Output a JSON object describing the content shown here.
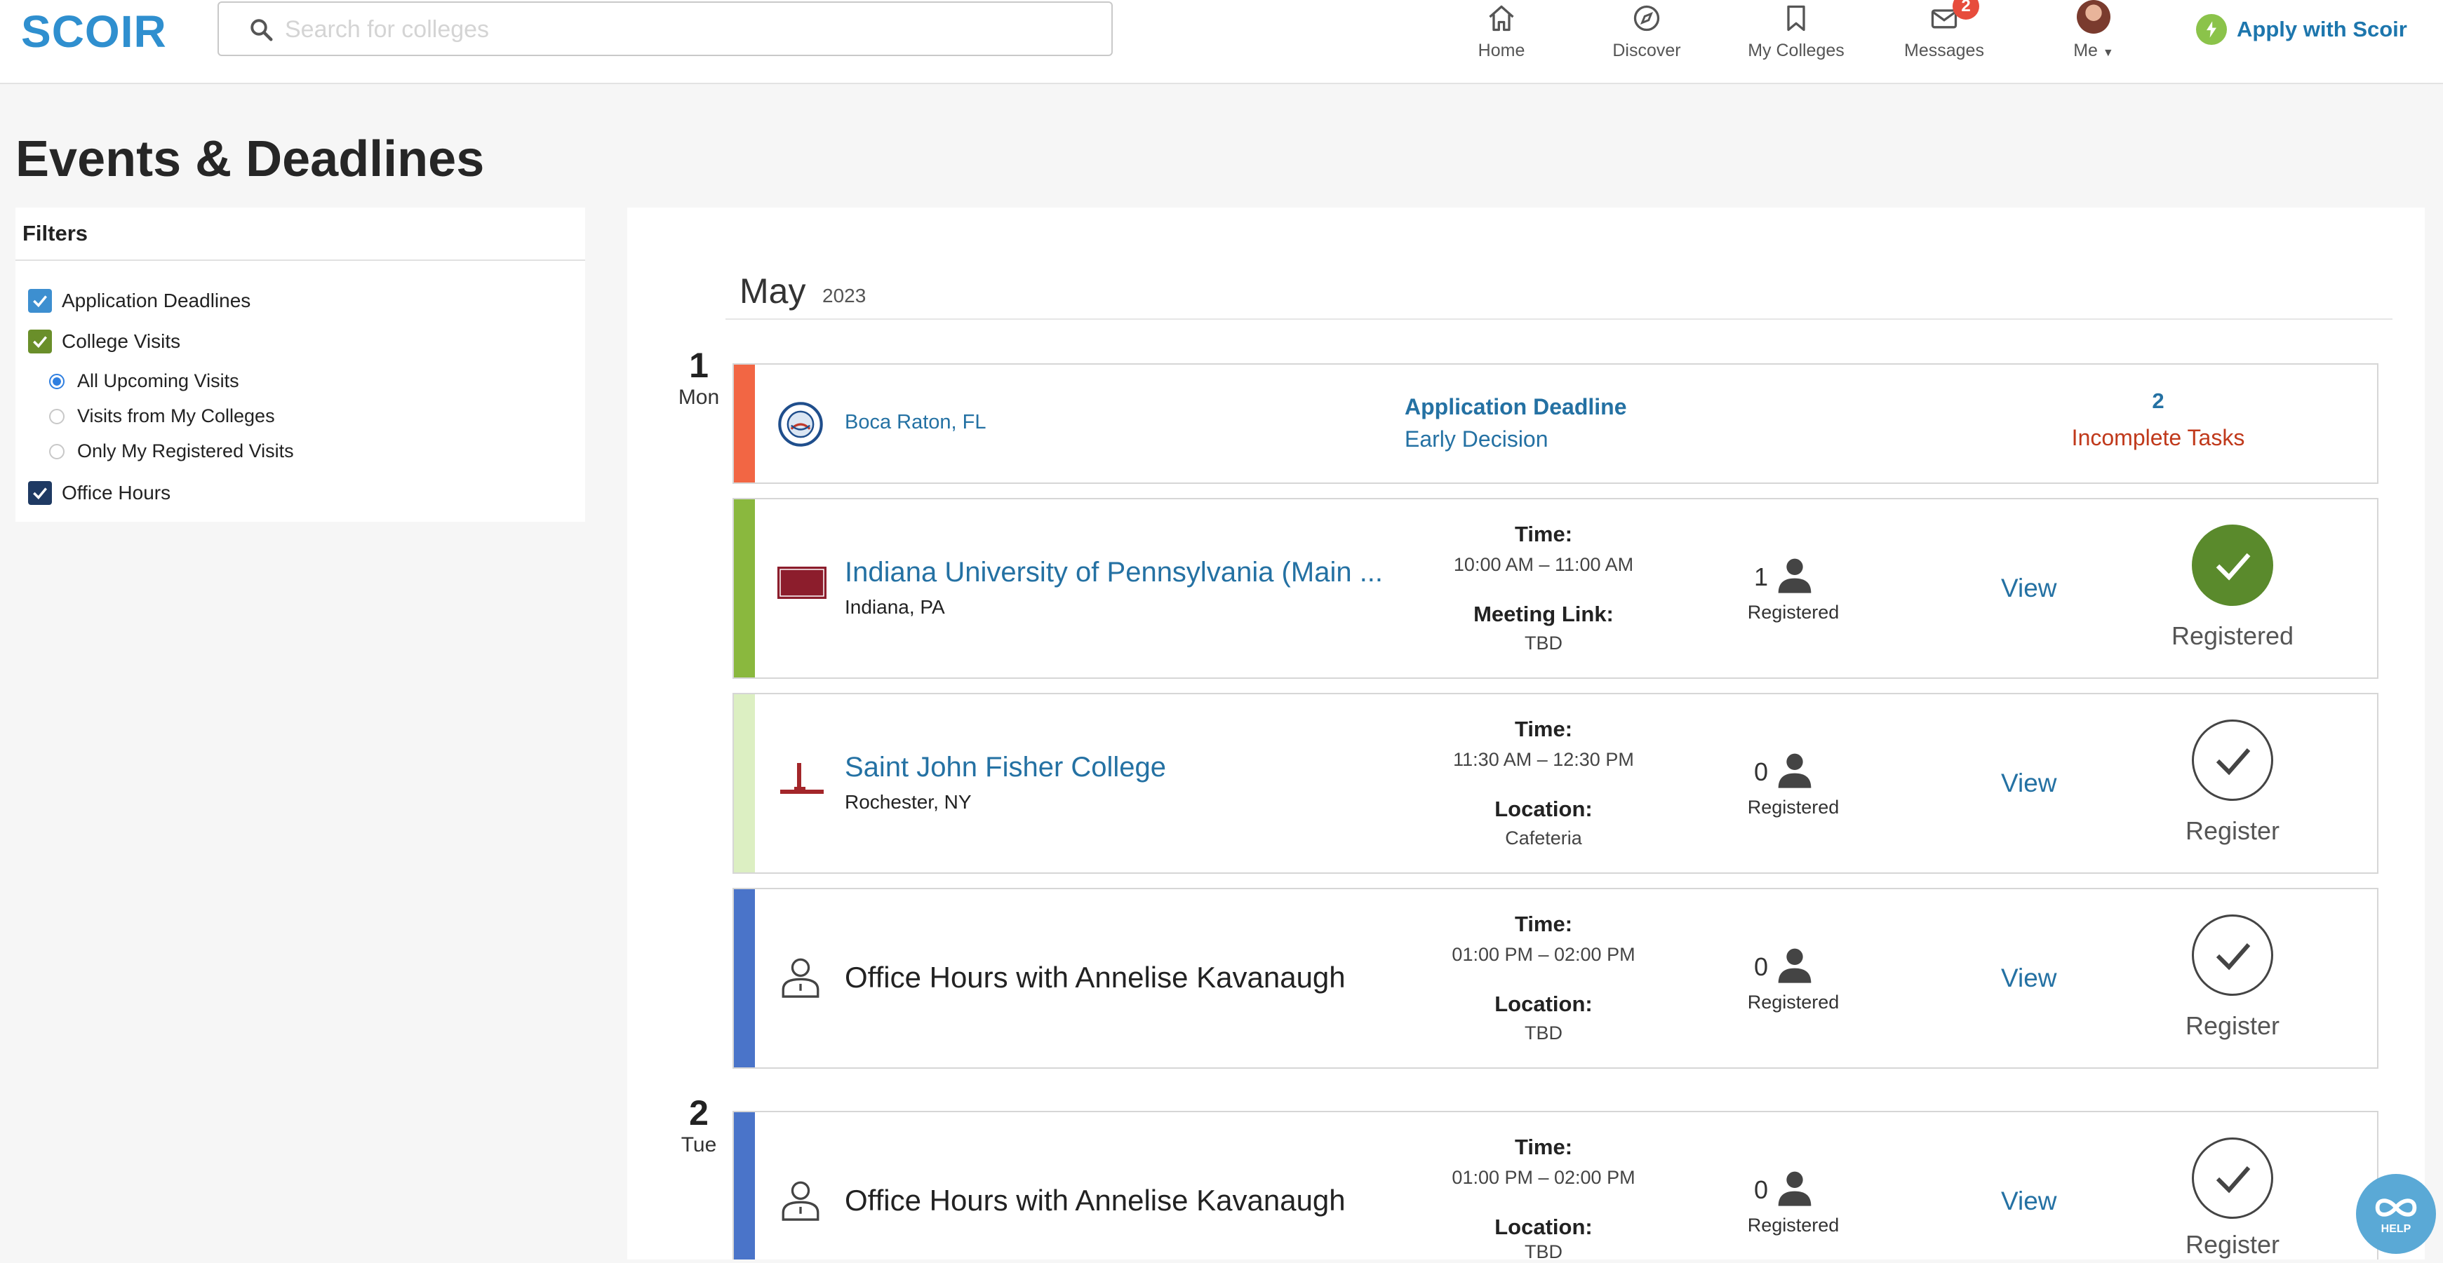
{
  "header": {
    "logo": "SCOIR",
    "search_placeholder": "Search for colleges",
    "nav": [
      {
        "label": "Home"
      },
      {
        "label": "Discover"
      },
      {
        "label": "My Colleges"
      },
      {
        "label": "Messages",
        "badge": "2"
      },
      {
        "label": "Me"
      }
    ],
    "apply_label": "Apply with Scoir"
  },
  "page_title": "Events & Deadlines",
  "filters": {
    "title": "Filters",
    "items": [
      {
        "label": "Application Deadlines",
        "checked": true,
        "color": "#3d8fd0"
      },
      {
        "label": "College Visits",
        "checked": true,
        "color": "#6a8f2a"
      },
      {
        "label": "All Upcoming Visits",
        "selected": true
      },
      {
        "label": "Visits from My Colleges",
        "selected": false
      },
      {
        "label": "Only My Registered Visits",
        "selected": false
      },
      {
        "label": "Office Hours",
        "checked": true,
        "color": "#1f3a63"
      }
    ]
  },
  "calendar": {
    "month": "May",
    "year": "2023",
    "days": [
      {
        "num": "1",
        "name": "Mon"
      },
      {
        "num": "2",
        "name": "Tue"
      }
    ],
    "deadline": {
      "location": "Boca Raton, FL",
      "type": "Application Deadline",
      "subtype": "Early Decision",
      "task_count": "2",
      "task_label": "Incomplete Tasks",
      "stripe_color": "#f26644"
    },
    "events": [
      {
        "title": "Indiana University of Pennsylvania (Main ...",
        "location": "Indiana, PA",
        "time_label": "Time:",
        "time": "10:00 AM – 11:00 AM",
        "detail_label": "Meeting Link:",
        "detail": "TBD",
        "count": "1",
        "registered_label": "Registered",
        "view": "View",
        "status": "Registered",
        "stripe_color": "#8ab83e"
      },
      {
        "title": "Saint John Fisher College",
        "location": "Rochester, NY",
        "time_label": "Time:",
        "time": "11:30 AM – 12:30 PM",
        "detail_label": "Location:",
        "detail": "Cafeteria",
        "count": "0",
        "registered_label": "Registered",
        "view": "View",
        "status": "Register",
        "stripe_color": "#dcefc2"
      },
      {
        "title": "Office Hours with Annelise Kavanaugh",
        "time_label": "Time:",
        "time": "01:00 PM – 02:00 PM",
        "detail_label": "Location:",
        "detail": "TBD",
        "count": "0",
        "registered_label": "Registered",
        "view": "View",
        "status": "Register",
        "stripe_color": "#4a74c9"
      },
      {
        "title": "Office Hours with Annelise Kavanaugh",
        "time_label": "Time:",
        "time": "01:00 PM – 02:00 PM",
        "detail_label": "Location:",
        "detail": "TBD",
        "count": "0",
        "registered_label": "Registered",
        "view": "View",
        "status": "Register",
        "stripe_color": "#4a74c9"
      }
    ]
  },
  "help_label": "HELP"
}
